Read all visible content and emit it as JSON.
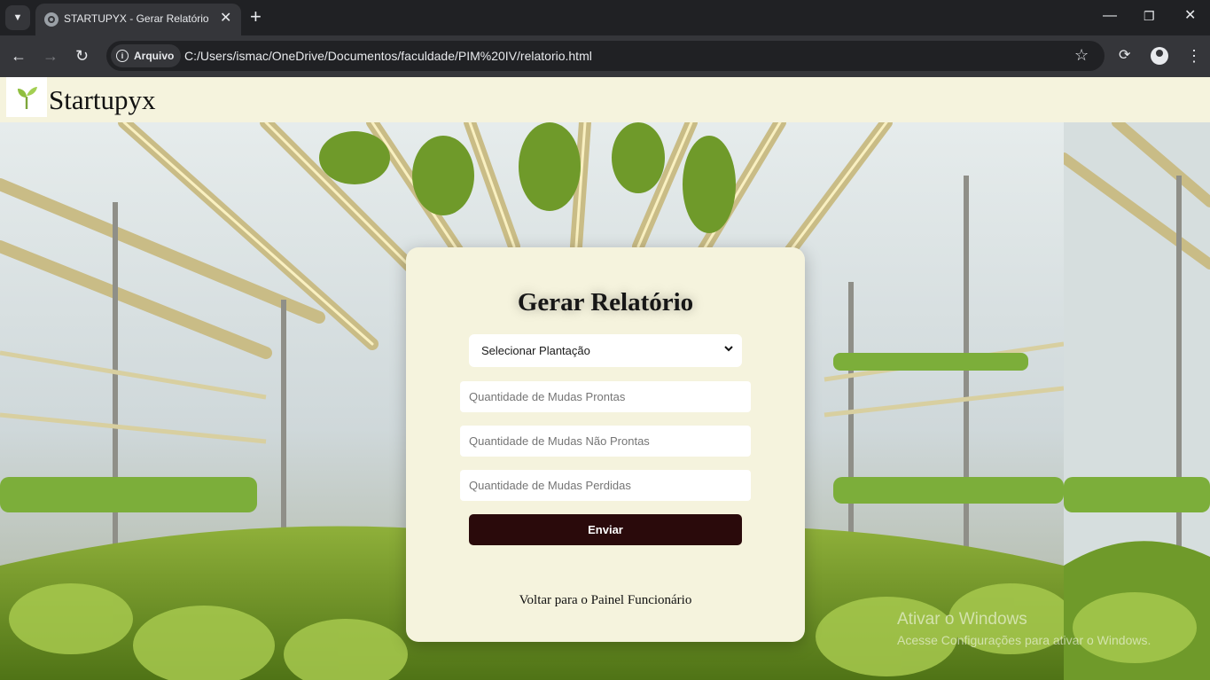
{
  "browser": {
    "tab_title": "STARTUPYX - Gerar Relatório",
    "site_chip": "Arquivo",
    "url": "C:/Users/ismac/OneDrive/Documentos/faculdade/PIM%20IV/relatorio.html"
  },
  "header": {
    "brand": "Startupyx",
    "logo_icon": "seedling-icon"
  },
  "form": {
    "title": "Gerar Relatório",
    "select_value": "Selecionar Plantação",
    "ready_placeholder": "Quantidade de Mudas Prontas",
    "not_ready_placeholder": "Quantidade de Mudas Não Prontas",
    "lost_placeholder": "Quantidade de Mudas Perdidas",
    "submit_label": "Enviar",
    "back_link": "Voltar para o Painel Funcionário"
  },
  "watermark": {
    "line1": "Ativar o Windows",
    "line2": "Acesse Configurações para ativar o Windows."
  },
  "colors": {
    "header_bg": "#f5f3dd",
    "card_bg": "#f5f3dd",
    "button_bg": "#2a0a0b"
  }
}
